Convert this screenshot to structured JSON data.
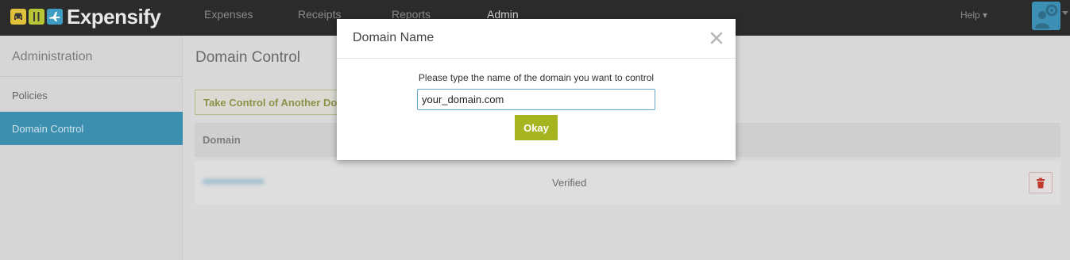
{
  "app": {
    "brand": "Expensify",
    "nav": [
      {
        "label": "Expenses"
      },
      {
        "label": "Receipts"
      },
      {
        "label": "Reports"
      },
      {
        "label": "Admin"
      }
    ],
    "help_label": "Help ▾"
  },
  "sidebar": {
    "title": "Administration",
    "items": [
      {
        "label": "Policies"
      },
      {
        "label": "Domain Control"
      }
    ]
  },
  "main": {
    "title": "Domain Control",
    "take_control_label": "Take Control of Another Domain",
    "table": {
      "header_domain": "Domain",
      "rows": [
        {
          "status": "Verified"
        }
      ]
    }
  },
  "modal": {
    "title": "Domain Name",
    "prompt": "Please type the name of the domain you want to control",
    "input_value": "your_domain.com",
    "okay_label": "Okay"
  },
  "colors": {
    "accent_blue": "#3d8fb0",
    "okay_green": "#a6b51f",
    "delete_red": "#c0392b"
  }
}
